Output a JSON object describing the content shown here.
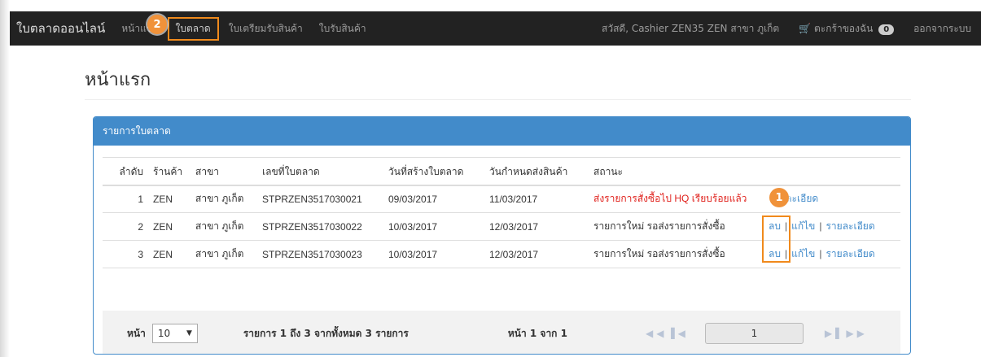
{
  "navbar": {
    "brand": "ใบตลาดออนไลน์",
    "items": [
      {
        "label": "หน้าแรก"
      },
      {
        "label": "ใบตลาด"
      },
      {
        "label": "ใบเตรียมรับสินค้า"
      },
      {
        "label": "ใบรับสินค้า"
      }
    ],
    "greeting": "สวัสดี, Cashier ZEN35 ZEN สาขา ภูเก็ต",
    "cart_label": "ตะกร้าของฉัน",
    "cart_count": "0",
    "logout": "ออกจากระบบ"
  },
  "callouts": {
    "one": "1",
    "two": "2"
  },
  "page": {
    "title": "หน้าแรก"
  },
  "panel": {
    "heading": "รายการใบตลาด",
    "columns": [
      "ลำดับ",
      "ร้านค้า",
      "สาขา",
      "เลขที่ใบตลาด",
      "วันที่สร้างใบตลาด",
      "วันกำหนดส่งสินค้า",
      "สถานะ"
    ],
    "rows": [
      {
        "no": "1",
        "store": "ZEN",
        "branch": "สาขา ภูเก็ต",
        "doc": "STPRZEN3517030021",
        "created": "09/03/2017",
        "due": "11/03/2017",
        "status": "ส่งรายการสั่งซื้อไป HQ เรียบร้อยแล้ว",
        "detail": "รายละเอียด"
      },
      {
        "no": "2",
        "store": "ZEN",
        "branch": "สาขา ภูเก็ต",
        "doc": "STPRZEN3517030022",
        "created": "10/03/2017",
        "due": "12/03/2017",
        "status": "รายการใหม่ รอส่งรายการสั่งซื้อ",
        "delete": "ลบ",
        "edit": "แก้ไข",
        "detail": "รายละเอียด"
      },
      {
        "no": "3",
        "store": "ZEN",
        "branch": "สาขา ภูเก็ต",
        "doc": "STPRZEN3517030023",
        "created": "10/03/2017",
        "due": "12/03/2017",
        "status": "รายการใหม่ รอส่งรายการสั่งซื้อ",
        "delete": "ลบ",
        "edit": "แก้ไข",
        "detail": "รายละเอียด"
      }
    ],
    "separator": "|"
  },
  "pager": {
    "page_label": "หน้า",
    "page_size": "10",
    "summary": "รายการ 1 ถึง 3 จากทั้งหมด 3 รายการ",
    "page_of": "หน้า 1 จาก 1",
    "current_page": "1"
  },
  "colors": {
    "navbar": "#222222",
    "panel": "#428bca",
    "highlight": "#f08a1c",
    "status_sent": "#e0201b"
  }
}
